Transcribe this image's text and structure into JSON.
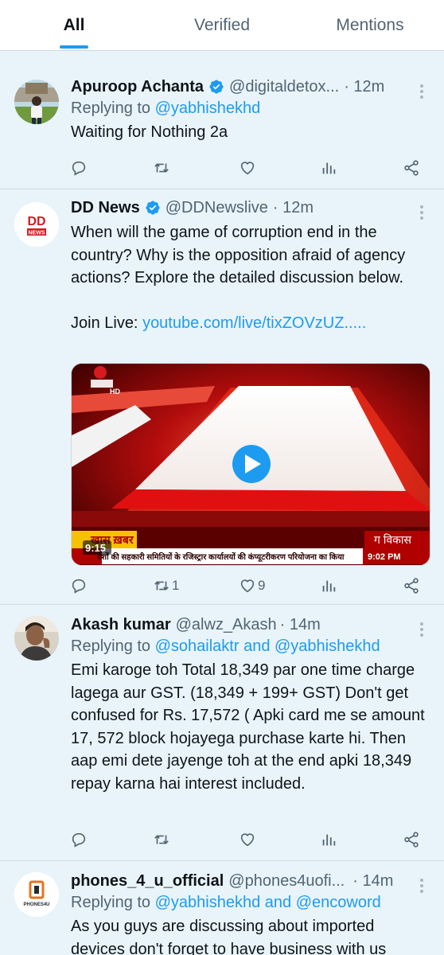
{
  "tabs": [
    {
      "label": "All",
      "active": true
    },
    {
      "label": "Verified",
      "active": false
    },
    {
      "label": "Mentions",
      "active": false
    }
  ],
  "tweets": [
    {
      "name": "Apuroop Achanta",
      "verified": true,
      "handle": "@digitaldetox...",
      "time": "· 12m",
      "reply_prefix": "Replying to",
      "reply_to": "@yabhishekhd",
      "text": "Waiting for Nothing 2a"
    },
    {
      "name": "DD News",
      "verified": true,
      "handle": "@DDNewslive",
      "time": "· 12m",
      "text": "When will the game of corruption end in the country? Why is the opposition afraid of agency actions? Explore the detailed discussion below.",
      "join_label": "Join Live:",
      "link": "youtube.com/live/tixZOVzUZ.....",
      "avatar_text_top": "DD",
      "avatar_text_bottom": "NEWS",
      "video": {
        "channel": "HD",
        "ticker_label": "खास ख़बर",
        "time_small": "9:15",
        "ticker_text": "देशों की सहकारी समितियों के रजिस्ट्रार कार्यालयों की कंप्यूटरीकरण परियोजना का किया",
        "right_label": "ग विकास",
        "clock": "9:02 PM"
      },
      "retweets": "1",
      "likes": "9"
    },
    {
      "name": "Akash kumar",
      "verified": false,
      "handle": "@alwz_Akash",
      "time": "· 14m",
      "reply_prefix": "Replying to",
      "reply_to": "@sohailaktr and @yabhishekhd",
      "text": "Emi karoge toh Total 18,349 par one time charge lagega aur GST. (18,349 + 199+ GST) Don't get confused for Rs.  17,572 ( Apki card me se amount 17, 572 block hojayega purchase karte hi. Then aap emi dete jayenge toh at the end apki 18,349 repay karna hai interest included."
    },
    {
      "name": "phones_4_u_official",
      "verified": false,
      "handle": "@phones4uofi...",
      "time": "· 14m",
      "reply_prefix": "Replying to",
      "reply_to": "@yabhishekhd and @encoword",
      "text": "As you guys are discussing about imported devices don't forget to have business with us",
      "avatar_text": "PHONES4U"
    }
  ],
  "colors": {
    "accent": "#1d9bf0",
    "background": "#e8f4fa",
    "muted": "#536471"
  }
}
